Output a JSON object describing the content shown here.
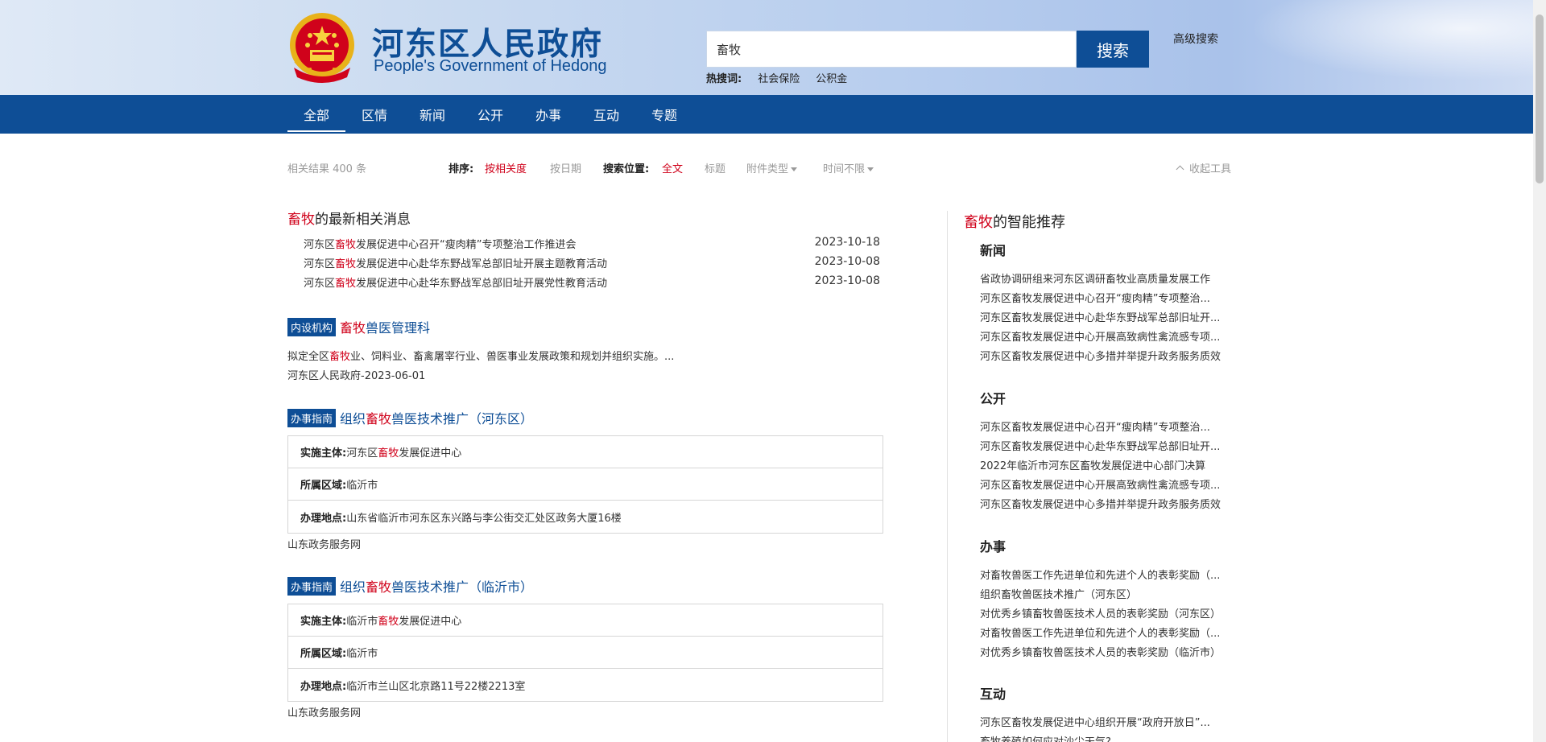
{
  "header": {
    "title": "河东区人民政府",
    "subtitle": "People's Government of Hedong",
    "search_value": "畜牧",
    "search_button": "搜索",
    "advanced_search": "高级搜索",
    "hot_label": "热搜词:",
    "hot_words": [
      "社会保险",
      "公积金"
    ]
  },
  "nav": {
    "items": [
      "全部",
      "区情",
      "新闻",
      "公开",
      "办事",
      "互动",
      "专题"
    ],
    "active": "全部"
  },
  "toolbar": {
    "result_count": "相关结果 400 条",
    "sort_label": "排序:",
    "sort_relevance": "按相关度",
    "sort_date": "按日期",
    "position_label": "搜索位置:",
    "position_full": "全文",
    "position_title": "标题",
    "attachment_type": "附件类型",
    "time_limit": "时间不限",
    "collapse": "收起工具"
  },
  "latest": {
    "keyword": "畜牧",
    "title_suffix": "的最新相关消息",
    "items": [
      {
        "pre": "河东区",
        "hl": "畜牧",
        "post": "发展促进中心召开“瘦肉精”专项整治工作推进会",
        "date": "2023-10-18"
      },
      {
        "pre": "河东区",
        "hl": "畜牧",
        "post": "发展促进中心赴华东野战军总部旧址开展主题教育活动",
        "date": "2023-10-08"
      },
      {
        "pre": "河东区",
        "hl": "畜牧",
        "post": "发展促进中心赴华东野战军总部旧址开展党性教育活动",
        "date": "2023-10-08"
      }
    ]
  },
  "result1": {
    "tag": "内设机构",
    "title_hl": "畜牧",
    "title_post": "兽医管理科",
    "desc_pre": "拟定全区",
    "desc_hl": "畜牧",
    "desc_post": "业、饲料业、畜禽屠宰行业、兽医事业发展政策和规划并组织实施。...",
    "source": "河东区人民政府-2023-06-01"
  },
  "result2": {
    "tag": "办事指南",
    "title_pre": "组织",
    "title_hl": "畜牧",
    "title_post": "兽医技术推广（河东区）",
    "rows": [
      {
        "k": "实施主体:",
        "pre": "河东区",
        "hl": "畜牧",
        "post": "发展促进中心"
      },
      {
        "k": "所属区域:",
        "pre": "临沂市",
        "hl": "",
        "post": ""
      },
      {
        "k": "办理地点:",
        "pre": "山东省临沂市河东区东兴路与李公街交汇处区政务大厦16楼",
        "hl": "",
        "post": ""
      }
    ],
    "source": "山东政务服务网"
  },
  "result3": {
    "tag": "办事指南",
    "title_pre": "组织",
    "title_hl": "畜牧",
    "title_post": "兽医技术推广（临沂市）",
    "rows": [
      {
        "k": "实施主体:",
        "pre": "临沂市",
        "hl": "畜牧",
        "post": "发展促进中心"
      },
      {
        "k": "所属区域:",
        "pre": "临沂市",
        "hl": "",
        "post": ""
      },
      {
        "k": "办理地点:",
        "pre": "临沂市兰山区北京路11号22楼2213室",
        "hl": "",
        "post": ""
      }
    ],
    "source": "山东政务服务网"
  },
  "recommend": {
    "keyword": "畜牧",
    "title_suffix": "的智能推荐",
    "groups": [
      {
        "name": "新闻",
        "items": [
          "省政协调研组来河东区调研畜牧业高质量发展工作",
          "河东区畜牧发展促进中心召开“瘦肉精”专项整治...",
          "河东区畜牧发展促进中心赴华东野战军总部旧址开...",
          "河东区畜牧发展促进中心开展高致病性禽流感专项...",
          "河东区畜牧发展促进中心多措并举提升政务服务质效"
        ]
      },
      {
        "name": "公开",
        "items": [
          "河东区畜牧发展促进中心召开“瘦肉精”专项整治...",
          "河东区畜牧发展促进中心赴华东野战军总部旧址开...",
          "2022年临沂市河东区畜牧发展促进中心部门决算",
          "河东区畜牧发展促进中心开展高致病性禽流感专项...",
          "河东区畜牧发展促进中心多措并举提升政务服务质效"
        ]
      },
      {
        "name": "办事",
        "items": [
          "对畜牧兽医工作先进单位和先进个人的表彰奖励（...",
          "组织畜牧兽医技术推广（河东区）",
          "对优秀乡镇畜牧兽医技术人员的表彰奖励（河东区）",
          "对畜牧兽医工作先进单位和先进个人的表彰奖励（...",
          "对优秀乡镇畜牧兽医技术人员的表彰奖励（临沂市）"
        ]
      },
      {
        "name": "互动",
        "items": [
          "河东区畜牧发展促进中心组织开展“政府开放日”...",
          "畜牧养殖如何应对沙尘天气?"
        ]
      }
    ]
  },
  "colors": {
    "brand": "#0e4e96",
    "highlight": "#d0021b"
  }
}
